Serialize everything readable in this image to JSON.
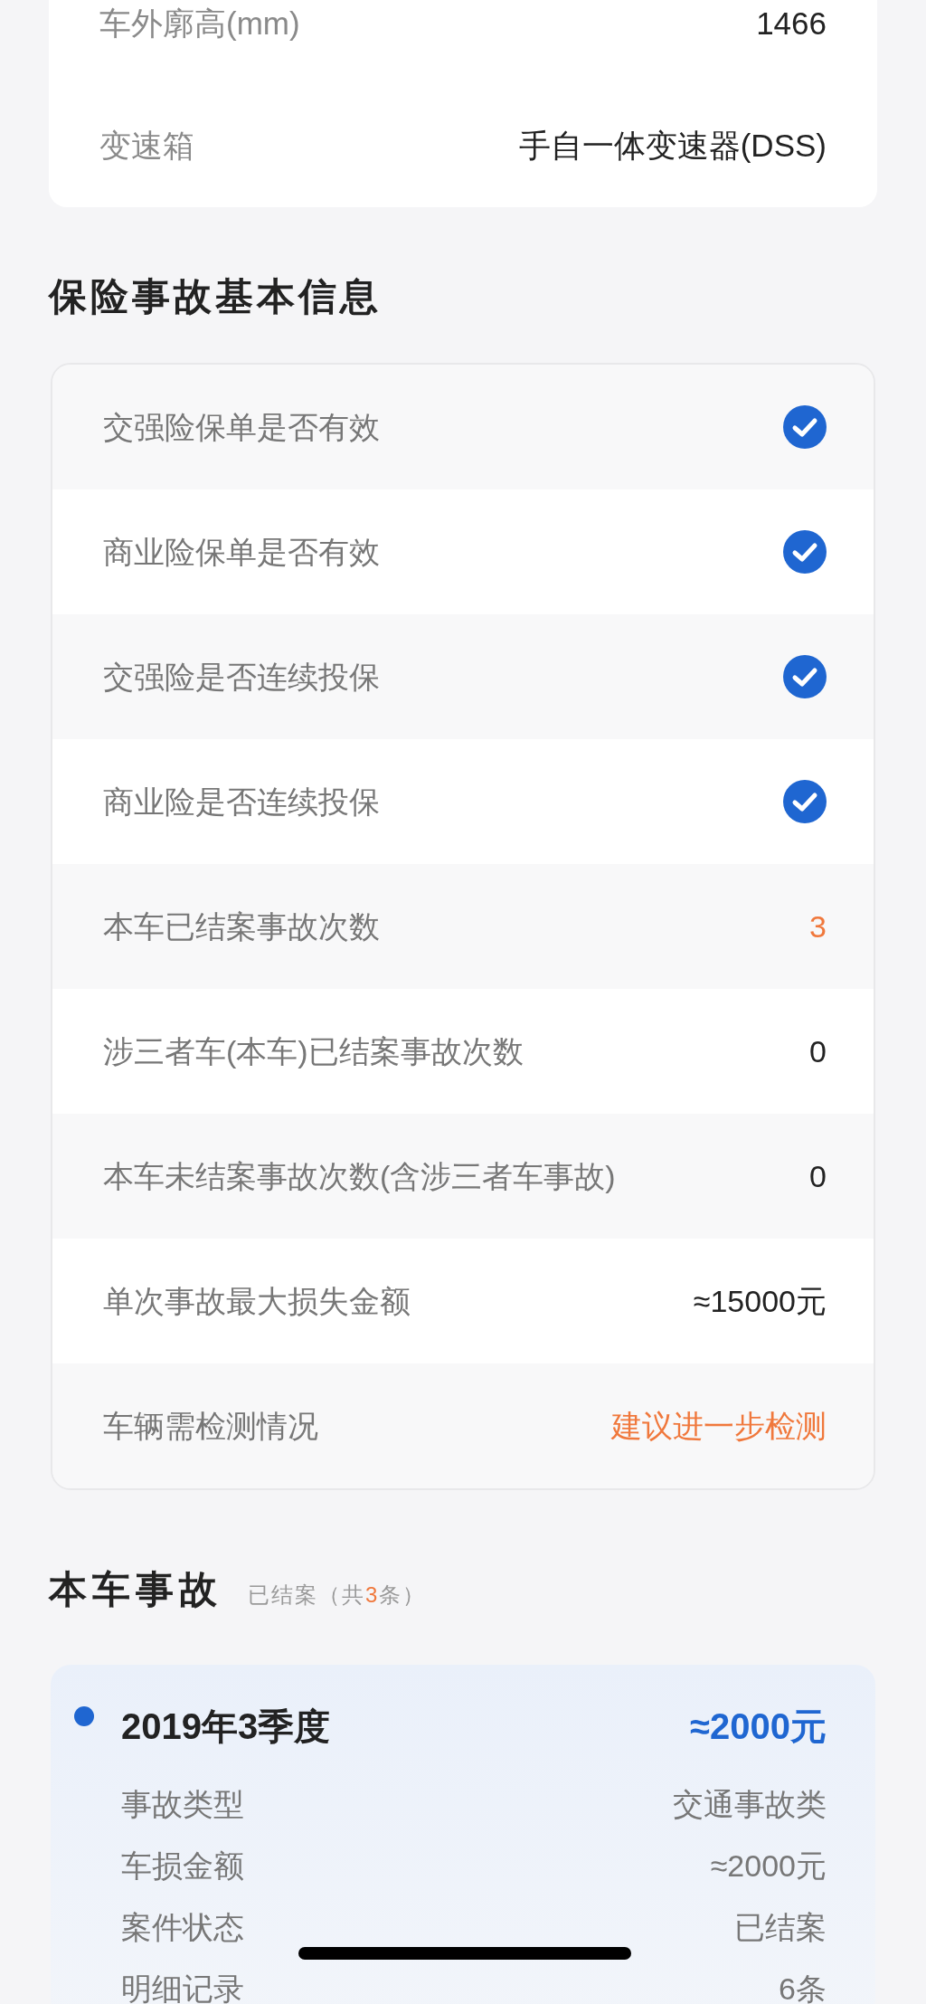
{
  "vehicle_specs": [
    {
      "label": "车外廓高(mm)",
      "value": "1466"
    },
    {
      "label": "变速箱",
      "value": "手自一体变速器(DSS)"
    }
  ],
  "insurance_section": {
    "title": "保险事故基本信息",
    "rows": [
      {
        "label": "交强险保单是否有效",
        "kind": "check",
        "checked": true
      },
      {
        "label": "商业险保单是否有效",
        "kind": "check",
        "checked": true
      },
      {
        "label": "交强险是否连续投保",
        "kind": "check",
        "checked": true
      },
      {
        "label": "商业险是否连续投保",
        "kind": "check",
        "checked": true
      },
      {
        "label": "本车已结案事故次数",
        "kind": "text",
        "value": "3",
        "highlight": true
      },
      {
        "label": "涉三者车(本车)已结案事故次数",
        "kind": "text",
        "value": "0",
        "highlight": false
      },
      {
        "label": "本车未结案事故次数(含涉三者车事故)",
        "kind": "text",
        "value": "0",
        "highlight": false
      },
      {
        "label": "单次事故最大损失金额",
        "kind": "text",
        "value": "≈15000元",
        "highlight": false
      },
      {
        "label": "车辆需检测情况",
        "kind": "text",
        "value": "建议进一步检测",
        "highlight": true
      }
    ]
  },
  "accidents_section": {
    "title": "本车事故",
    "subtitle": {
      "prefix": "已结案（共",
      "count": "3",
      "suffix": "条）"
    },
    "accidents": [
      {
        "period": "2019年3季度",
        "amount": "≈2000元",
        "details": [
          {
            "label": "事故类型",
            "value": "交通事故类"
          },
          {
            "label": "车损金额",
            "value": "≈2000元"
          },
          {
            "label": "案件状态",
            "value": "已结案"
          },
          {
            "label": "明细记录",
            "value": "6条"
          }
        ]
      }
    ]
  }
}
